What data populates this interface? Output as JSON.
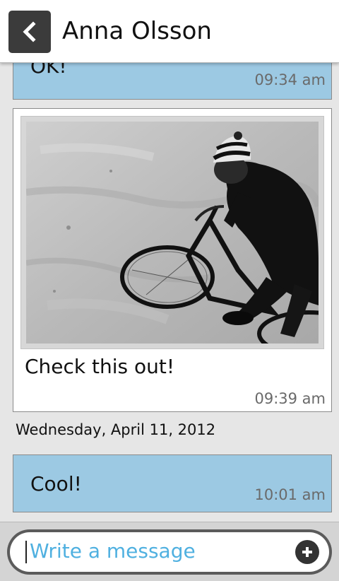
{
  "header": {
    "title": "Anna Olsson",
    "back_icon": "chevron-left-icon"
  },
  "messages": [
    {
      "text": "OK!",
      "time": "09:34 am",
      "style": "incoming"
    },
    {
      "text": "Check this out!",
      "time": "09:39 am",
      "style": "outgoing",
      "has_image": true,
      "image_subject": "black-and-white photo of a cyclist in a striped beanie riding a bike"
    },
    {
      "text": "Cool!",
      "time": "10:01 am",
      "style": "incoming"
    }
  ],
  "date_separator": "Wednesday, April 11, 2012",
  "composer": {
    "placeholder": "Write a message",
    "add_icon": "plus-circle-icon"
  },
  "colors": {
    "incoming_bubble": "#9cc9e3",
    "outgoing_bubble": "#ffffff",
    "placeholder": "#4fb0e0",
    "header_button": "#3b3b3b"
  }
}
